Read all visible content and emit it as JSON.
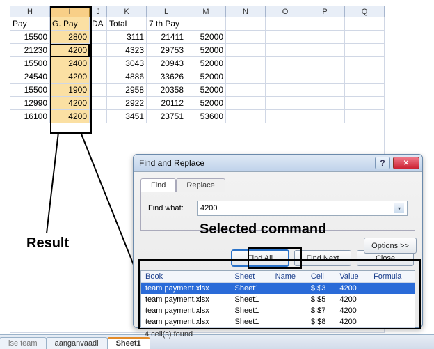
{
  "columns": [
    "H",
    "I",
    "J",
    "K",
    "L",
    "M",
    "N",
    "O",
    "P",
    "Q"
  ],
  "headers": {
    "H": "Pay",
    "I": "G. Pay",
    "J": "DA",
    "K": "Total",
    "L": "7 th Pay",
    "M": ""
  },
  "rows": [
    {
      "H": "15500",
      "I": "2800",
      "J": "",
      "K": "3111",
      "L": "21411",
      "M": "52000"
    },
    {
      "H": "21230",
      "I": "4200",
      "J": "",
      "K": "4323",
      "L": "29753",
      "M": "52000"
    },
    {
      "H": "15500",
      "I": "2400",
      "J": "",
      "K": "3043",
      "L": "20943",
      "M": "52000"
    },
    {
      "H": "24540",
      "I": "4200",
      "J": "",
      "K": "4886",
      "L": "33626",
      "M": "52000"
    },
    {
      "H": "15500",
      "I": "1900",
      "J": "",
      "K": "2958",
      "L": "20358",
      "M": "52000"
    },
    {
      "H": "12990",
      "I": "4200",
      "J": "",
      "K": "2922",
      "L": "20112",
      "M": "52000"
    },
    {
      "H": "16100",
      "I": "4200",
      "J": "",
      "K": "3451",
      "L": "23751",
      "M": "53600"
    }
  ],
  "annotations": {
    "result": "Result",
    "selected_command": "Selected command"
  },
  "dialog": {
    "title": "Find and Replace",
    "tab_find": "Find",
    "tab_replace": "Replace",
    "find_what_label": "Find what:",
    "find_what_value": "4200",
    "options_btn": "Options >>",
    "find_all_btn": "Find All",
    "find_next_btn": "Find Next",
    "close_btn": "Close",
    "help_glyph": "?",
    "close_glyph": "✕",
    "dropdown_glyph": "▾",
    "results_headers": {
      "book": "Book",
      "sheet": "Sheet",
      "name": "Name",
      "cell": "Cell",
      "value": "Value",
      "formula": "Formula"
    },
    "results": [
      {
        "book": "team payment.xlsx",
        "sheet": "Sheet1",
        "name": "",
        "cell": "$I$3",
        "value": "4200",
        "formula": ""
      },
      {
        "book": "team payment.xlsx",
        "sheet": "Sheet1",
        "name": "",
        "cell": "$I$5",
        "value": "4200",
        "formula": ""
      },
      {
        "book": "team payment.xlsx",
        "sheet": "Sheet1",
        "name": "",
        "cell": "$I$7",
        "value": "4200",
        "formula": ""
      },
      {
        "book": "team payment.xlsx",
        "sheet": "Sheet1",
        "name": "",
        "cell": "$I$8",
        "value": "4200",
        "formula": ""
      }
    ],
    "status": "4 cell(s) found"
  },
  "sheet_tabs": {
    "t0": "ise team",
    "t1": "aanganvaadi",
    "active": "Sheet1"
  }
}
